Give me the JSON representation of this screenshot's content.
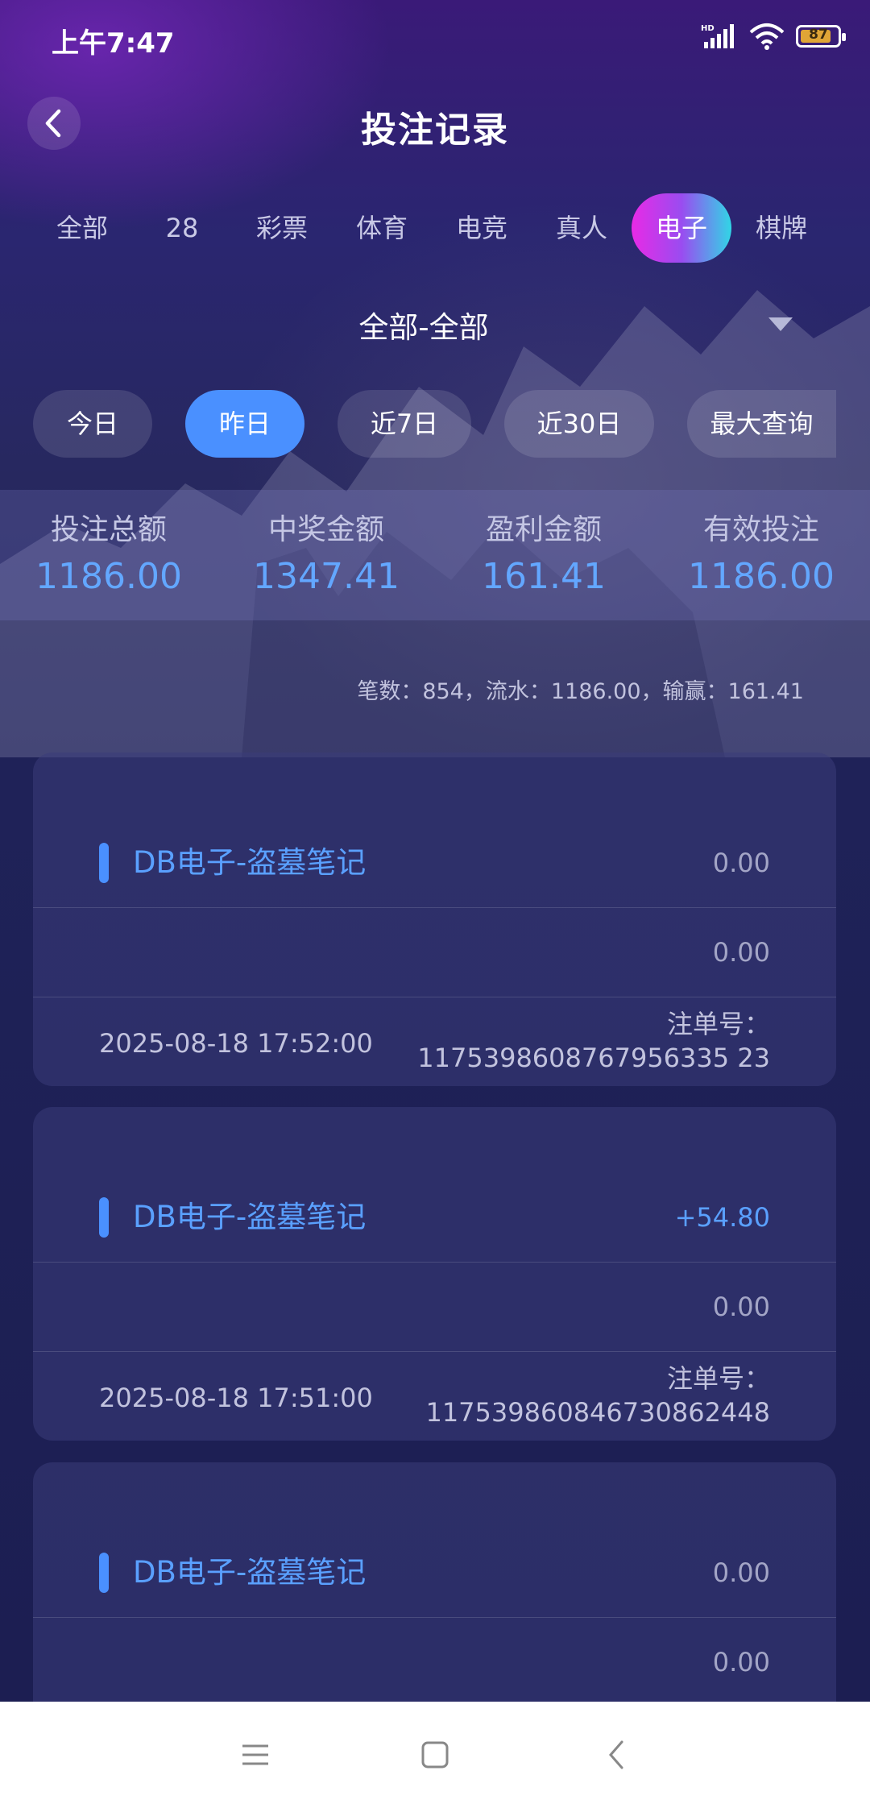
{
  "status_bar": {
    "time": "上午7:47",
    "network": "HD",
    "battery": "87",
    "icons": [
      "signal-icon",
      "wifi-icon",
      "battery-icon"
    ]
  },
  "header": {
    "title": "投注记录",
    "back_icon": "chevron-left-icon"
  },
  "categories": {
    "items": [
      "全部",
      "28",
      "彩票",
      "体育",
      "电竞",
      "真人",
      "电子",
      "棋牌"
    ],
    "active": "电子"
  },
  "filter": {
    "selected": "全部-全部",
    "icon": "caret-down-icon"
  },
  "date_filters": {
    "items": [
      "今日",
      "昨日",
      "近7日",
      "近30日",
      "最大查询"
    ],
    "active": "昨日"
  },
  "summary": {
    "items": [
      {
        "label": "投注总额",
        "value": "1186.00"
      },
      {
        "label": "中奖金额",
        "value": "1347.41"
      },
      {
        "label": "盈利金额",
        "value": "161.41"
      },
      {
        "label": "有效投注",
        "value": "1186.00"
      }
    ]
  },
  "stats_line": "笔数：854，流水：1186.00，输赢：161.41",
  "records": [
    {
      "game": "DB电子-盗墓笔记",
      "amount": "0.00",
      "amount2": "0.00",
      "datetime": "2025-08-18 17:52:00",
      "order_label": "注单号：",
      "order_no": "1175398608767956335 23"
    },
    {
      "game": "DB电子-盗墓笔记",
      "amount": "+54.80",
      "amount2": "0.00",
      "datetime": "2025-08-18 17:51:00",
      "order_label": "注单号：",
      "order_no": "117539860846730862448"
    },
    {
      "game": "DB电子-盗墓笔记",
      "amount": "0.00",
      "amount2": "0.00",
      "datetime": "",
      "order_label": "",
      "order_no": ""
    }
  ],
  "colors": {
    "accent": "#4a90ff",
    "active_tab_gradient": [
      "#e82ae6",
      "#31d6e6"
    ],
    "background": "#1f2258"
  },
  "nav_bar": {
    "icons": [
      "menu-icon",
      "home-square-icon",
      "back-icon"
    ]
  }
}
